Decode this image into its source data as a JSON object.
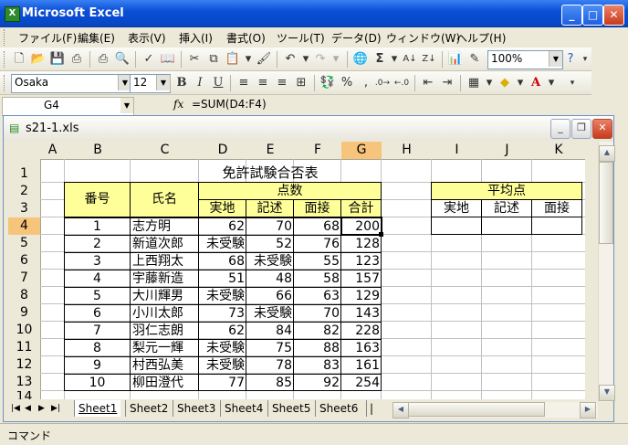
{
  "app": {
    "title": "Microsoft Excel"
  },
  "menu": [
    "ファイル(F)",
    "編集(E)",
    "表示(V)",
    "挿入(I)",
    "書式(O)",
    "ツール(T)",
    "データ(D)",
    "ウィンドウ(W)",
    "ヘルプ(H)"
  ],
  "toolbar": {
    "zoom": "100%"
  },
  "format_bar": {
    "font": "Osaka",
    "size": "12"
  },
  "formula_bar": {
    "name_box": "G4",
    "fx": "fx",
    "formula": "=SUM(D4:F4)"
  },
  "workbook": {
    "title": "s21-1.xls"
  },
  "columns": [
    "A",
    "B",
    "C",
    "D",
    "E",
    "F",
    "G",
    "H",
    "I",
    "J",
    "K"
  ],
  "rows": [
    "1",
    "2",
    "3",
    "4",
    "5",
    "6",
    "7",
    "8",
    "9",
    "10",
    "11",
    "12",
    "13",
    "14"
  ],
  "sheet": {
    "title": "免許試験合否表",
    "h_number": "番号",
    "h_name": "氏名",
    "h_points": "点数",
    "h_practical": "実地",
    "h_written": "記述",
    "h_interview": "面接",
    "h_total": "合計",
    "avg_title": "平均点",
    "avg_practical": "実地",
    "avg_written": "記述",
    "avg_interview": "面接",
    "data": [
      [
        "1",
        "志方明",
        "62",
        "70",
        "68",
        "200"
      ],
      [
        "2",
        "新道次郎",
        "未受験",
        "52",
        "76",
        "128"
      ],
      [
        "3",
        "上西翔太",
        "68",
        "未受験",
        "55",
        "123"
      ],
      [
        "4",
        "宇藤新造",
        "51",
        "48",
        "58",
        "157"
      ],
      [
        "5",
        "大川輝男",
        "未受験",
        "66",
        "63",
        "129"
      ],
      [
        "6",
        "小川太郎",
        "73",
        "未受験",
        "70",
        "143"
      ],
      [
        "7",
        "羽仁志朗",
        "62",
        "84",
        "82",
        "228"
      ],
      [
        "8",
        "梨元一輝",
        "未受験",
        "75",
        "88",
        "163"
      ],
      [
        "9",
        "村西弘美",
        "未受験",
        "78",
        "83",
        "161"
      ],
      [
        "10",
        "柳田澄代",
        "77",
        "85",
        "92",
        "254"
      ]
    ]
  },
  "tabs": [
    "Sheet1",
    "Sheet2",
    "Sheet3",
    "Sheet4",
    "Sheet5",
    "Sheet6"
  ],
  "status": "コマンド"
}
